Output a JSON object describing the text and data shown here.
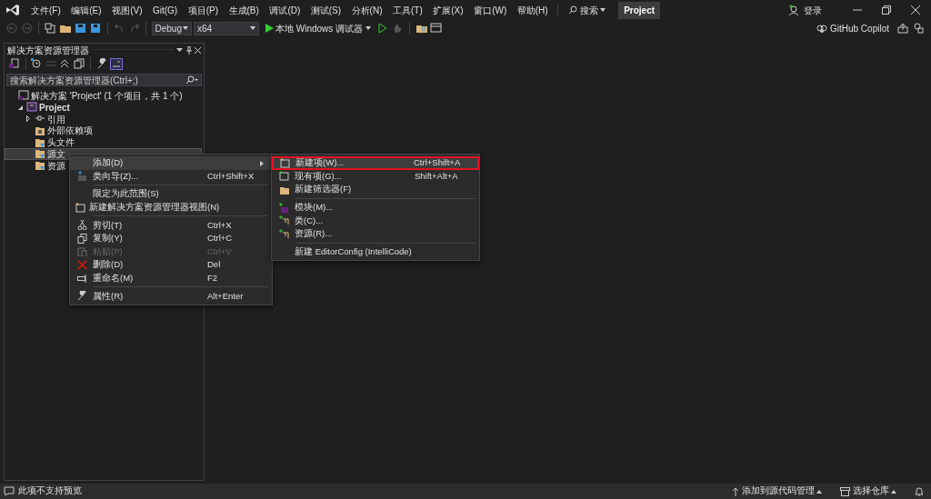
{
  "menubar": {
    "items": [
      "文件(F)",
      "编辑(E)",
      "视图(V)",
      "Git(G)",
      "项目(P)",
      "生成(B)",
      "调试(D)",
      "测试(S)",
      "分析(N)",
      "工具(T)",
      "扩展(X)",
      "窗口(W)",
      "帮助(H)"
    ],
    "search": "搜索",
    "project": "Project",
    "signin": "登录"
  },
  "toolbar": {
    "configuration": "Debug",
    "platform": "x64",
    "run": "本地 Windows 调试器",
    "copilot": "GitHub Copilot"
  },
  "solution_explorer": {
    "title": "解决方案资源管理器",
    "search": {
      "placeholder": "搜索解决方案资源管理器(Ctrl+;)"
    },
    "tree": [
      {
        "label": "解决方案 'Project' (1 个项目，共 1 个)",
        "selected": false,
        "children": [
          {
            "label": "Project",
            "selected": false,
            "expanded": true,
            "children": [
              {
                "label": "引用",
                "selected": false,
                "expanded": false
              },
              {
                "label": "外部依赖项",
                "selected": false
              },
              {
                "label": "头文件",
                "selected": false
              },
              {
                "label": "源文",
                "selected": true
              },
              {
                "label": "资源",
                "selected": false
              }
            ]
          }
        ]
      }
    ]
  },
  "context_menu": {
    "items": [
      {
        "kind": "item",
        "label": "添加(D)",
        "selected": true,
        "submenu": true
      },
      {
        "kind": "item",
        "label": "类向导(Z)...",
        "shortcut": "Ctrl+Shift+X",
        "selected": false
      },
      {
        "kind": "separator"
      },
      {
        "kind": "item",
        "label": "限定为此范围(S)",
        "selected": false
      },
      {
        "kind": "item",
        "label": "新建解决方案资源管理器视图(N)",
        "selected": false
      },
      {
        "kind": "separator"
      },
      {
        "kind": "item",
        "label": "剪切(T)",
        "shortcut": "Ctrl+X",
        "selected": false
      },
      {
        "kind": "item",
        "label": "复制(Y)",
        "shortcut": "Ctrl+C",
        "selected": false
      },
      {
        "kind": "item",
        "label": "粘贴(P)",
        "shortcut": "Ctrl+V",
        "selected": false,
        "disabled": true
      },
      {
        "kind": "item",
        "label": "删除(D)",
        "shortcut": "Del",
        "selected": false
      },
      {
        "kind": "item",
        "label": "重命名(M)",
        "shortcut": "F2",
        "selected": false
      },
      {
        "kind": "separator"
      },
      {
        "kind": "item",
        "label": "属性(R)",
        "shortcut": "Alt+Enter",
        "selected": false
      }
    ]
  },
  "submenu": {
    "items": [
      {
        "kind": "item",
        "label": "新建项(W)...",
        "shortcut": "Ctrl+Shift+A",
        "selected": true
      },
      {
        "kind": "item",
        "label": "现有项(G)...",
        "shortcut": "Shift+Alt+A",
        "selected": false
      },
      {
        "kind": "item",
        "label": "新建筛选器(F)",
        "selected": false
      },
      {
        "kind": "separator"
      },
      {
        "kind": "item",
        "label": "模块(M)...",
        "selected": false
      },
      {
        "kind": "item",
        "label": "类(C)...",
        "selected": false
      },
      {
        "kind": "item",
        "label": "资源(R)...",
        "selected": false
      },
      {
        "kind": "separator"
      },
      {
        "kind": "item",
        "label": "新建 EditorConfig (IntelliCode)",
        "selected": false
      }
    ]
  },
  "status_bar": {
    "message": "此项不支持预览",
    "source_control": "添加到源代码管理",
    "repository": "选择仓库"
  }
}
